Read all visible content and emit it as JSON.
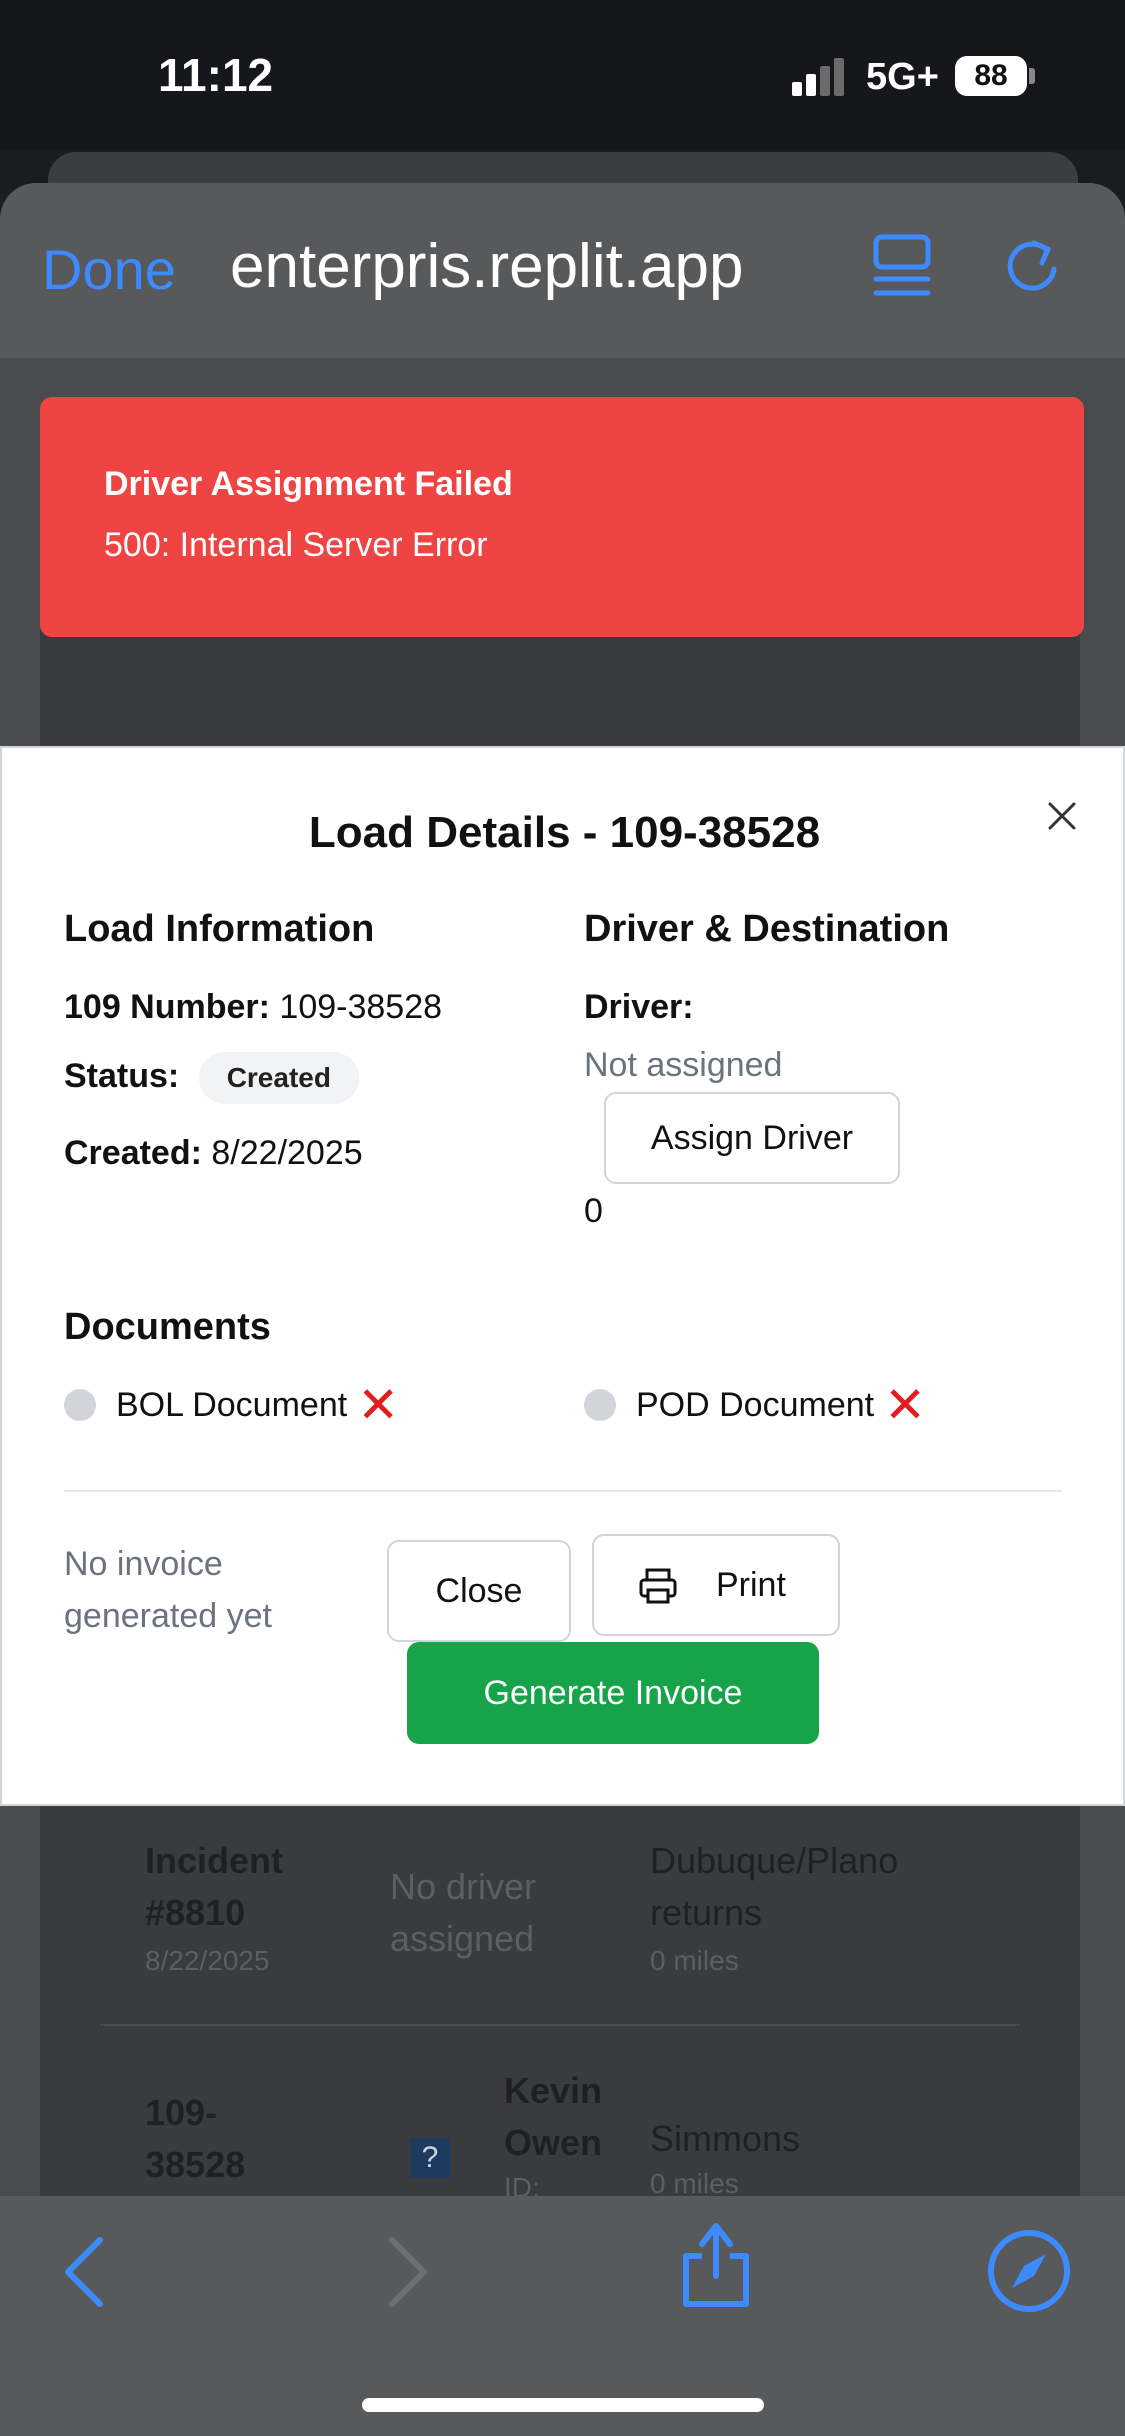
{
  "status_bar": {
    "time": "11:12",
    "network": "5G+",
    "battery": "88"
  },
  "browser": {
    "done_label": "Done",
    "url": "enterpris.replit.app"
  },
  "toast": {
    "title": "Driver Assignment Failed",
    "message": "500: Internal Server Error",
    "color": "#ef4444"
  },
  "modal": {
    "title": "Load Details - 109-38528",
    "load_info": {
      "heading": "Load Information",
      "number_label": "109 Number:",
      "number_value": "109-38528",
      "status_label": "Status:",
      "status_value": "Created",
      "created_label": "Created:",
      "created_value": "8/22/2025"
    },
    "driver_dest": {
      "heading": "Driver & Destination",
      "driver_label": "Driver:",
      "driver_value": "Not assigned",
      "assign_button": "Assign Driver",
      "count": "0"
    },
    "documents": {
      "heading": "Documents",
      "items": [
        {
          "label": "BOL Document"
        },
        {
          "label": "POD Document"
        }
      ]
    },
    "footer": {
      "invoice_status": "No invoice generated yet",
      "close_button": "Close",
      "print_button": "Print",
      "generate_button": "Generate Invoice",
      "accent": "#16a34a"
    }
  },
  "background_rows": [
    {
      "id_line1": "Incident",
      "id_line2": "#8810",
      "date": "8/22/2025",
      "driver_line1": "No driver",
      "driver_line2": "assigned",
      "dest_line1": "Dubuque/Plano",
      "dest_line2": "returns",
      "miles": "0 miles"
    },
    {
      "id_line1": "109-",
      "id_line2": "38528",
      "driver_line1": "Kevin",
      "driver_line2": "Owen",
      "driver_line3": "ID:",
      "icon": "?",
      "dest_line1": "Simmons",
      "miles": "0 miles"
    }
  ]
}
